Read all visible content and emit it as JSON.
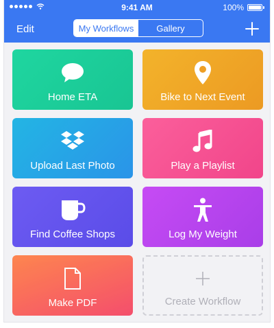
{
  "status_bar": {
    "time": "9:41 AM",
    "battery": "100%"
  },
  "nav": {
    "edit_label": "Edit",
    "tabs": [
      {
        "label": "My Workflows",
        "active": true
      },
      {
        "label": "Gallery",
        "active": false
      }
    ],
    "add_icon": "plus-icon"
  },
  "workflows": [
    {
      "label": "Home ETA",
      "icon": "speech-bubble-icon",
      "color": "#1fd6a0"
    },
    {
      "label": "Bike to Next Event",
      "icon": "location-pin-icon",
      "color": "#f3b32b"
    },
    {
      "label": "Upload Last Photo",
      "icon": "dropbox-icon",
      "color": "#23b5e4"
    },
    {
      "label": "Play a Playlist",
      "icon": "music-note-icon",
      "color": "#fb5f9b"
    },
    {
      "label": "Find Coffee Shops",
      "icon": "coffee-cup-icon",
      "color": "#6d5bf2"
    },
    {
      "label": "Log My Weight",
      "icon": "person-icon",
      "color": "#c64bf4"
    },
    {
      "label": "Make PDF",
      "icon": "document-icon",
      "color": "#ff7a3d"
    }
  ],
  "create_workflow": {
    "label": "Create Workflow",
    "icon": "plus-icon"
  },
  "colors": {
    "accent": "#3a78f2",
    "background": "#f2f2f5"
  }
}
